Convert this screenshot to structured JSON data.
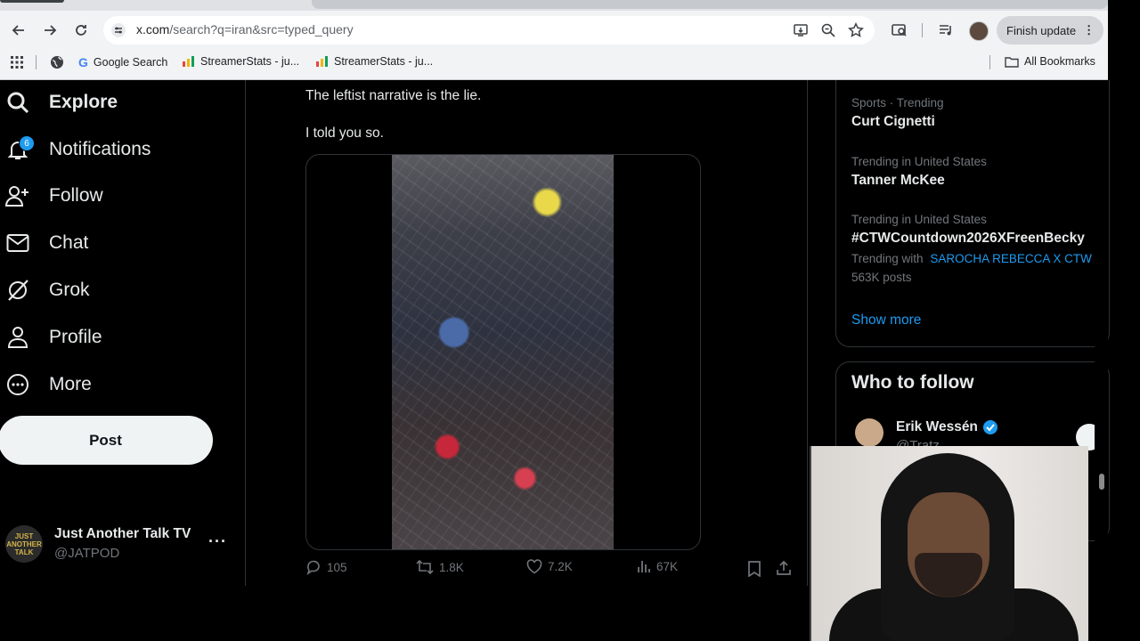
{
  "browser": {
    "url_host": "x.com",
    "url_path": "/search?q=iran&src=typed_query",
    "finish_update_label": "Finish update",
    "bookmarks": [
      {
        "label": "Google Search"
      },
      {
        "label": "StreamerStats - ju..."
      },
      {
        "label": "StreamerStats - ju..."
      }
    ],
    "all_bookmarks_label": "All Bookmarks"
  },
  "nav": {
    "items": [
      {
        "label": "Explore",
        "icon": "search-icon"
      },
      {
        "label": "Notifications",
        "icon": "bell-icon",
        "badge": "6"
      },
      {
        "label": "Follow",
        "icon": "follow-icon"
      },
      {
        "label": "Chat",
        "icon": "mail-icon"
      },
      {
        "label": "Grok",
        "icon": "grok-icon"
      },
      {
        "label": "Profile",
        "icon": "person-icon"
      },
      {
        "label": "More",
        "icon": "more-circle-icon"
      }
    ],
    "post_label": "Post",
    "account": {
      "name": "Just Another Talk TV",
      "handle": "@JATPOD",
      "avatar_text": "JUST ANOTHER TALK"
    }
  },
  "tweet": {
    "line1": "The leftist narrative is the lie.",
    "line2": "I told you so.",
    "actions": {
      "replies": "105",
      "reposts": "1.8K",
      "likes": "7.2K",
      "views": "67K"
    }
  },
  "sidebar": {
    "trends": [
      {
        "category": "Sports · Trending",
        "name": "Curt Cignetti"
      },
      {
        "category": "Trending in United States",
        "name": "Tanner McKee"
      },
      {
        "category": "Trending in United States",
        "name": "#CTWCountdown2026XFreenBecky",
        "with_prefix": "Trending with",
        "with_link": "SAROCHA REBECCA X CTW E",
        "posts": "563K posts"
      }
    ],
    "show_more_label": "Show more",
    "who_to_follow_title": "Who to follow",
    "suggestion": {
      "name": "Erik Wessén",
      "handle": "@Tratz"
    }
  },
  "colors": {
    "accent": "#1d9bf0",
    "background": "#000000",
    "text": "#e7e9ea",
    "muted": "#71767b"
  }
}
